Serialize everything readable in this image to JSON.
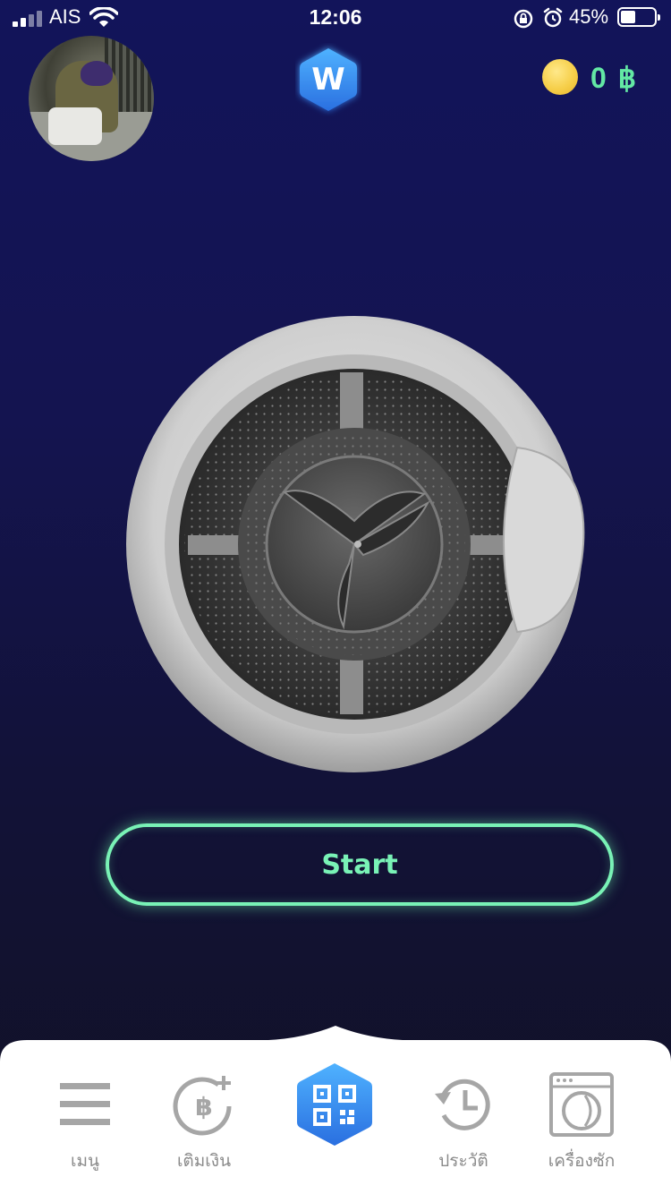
{
  "status_bar": {
    "carrier": "AIS",
    "time": "12:06",
    "battery_percent": "45%",
    "battery_level": 0.45,
    "icons": [
      "signal-icon",
      "wifi-icon",
      "rotation-lock-icon",
      "alarm-icon",
      "battery-icon"
    ]
  },
  "header": {
    "logo_letter": "W",
    "balance": "0 ฿",
    "icons": [
      "avatar",
      "coin-icon"
    ]
  },
  "main": {
    "start_label": "Start"
  },
  "nav": {
    "items": [
      {
        "label": "เมนู",
        "icon": "menu-icon"
      },
      {
        "label": "เติมเงิน",
        "icon": "topup-icon"
      },
      {
        "label": "",
        "icon": "qr-scan-icon"
      },
      {
        "label": "ประวัติ",
        "icon": "history-icon"
      },
      {
        "label": "เครื่องซัก",
        "icon": "washing-machine-icon"
      }
    ]
  },
  "colors": {
    "accent_green": "#79f2b6",
    "logo_blue": "#2f8cf0",
    "nav_gray": "#8a8a8a"
  }
}
